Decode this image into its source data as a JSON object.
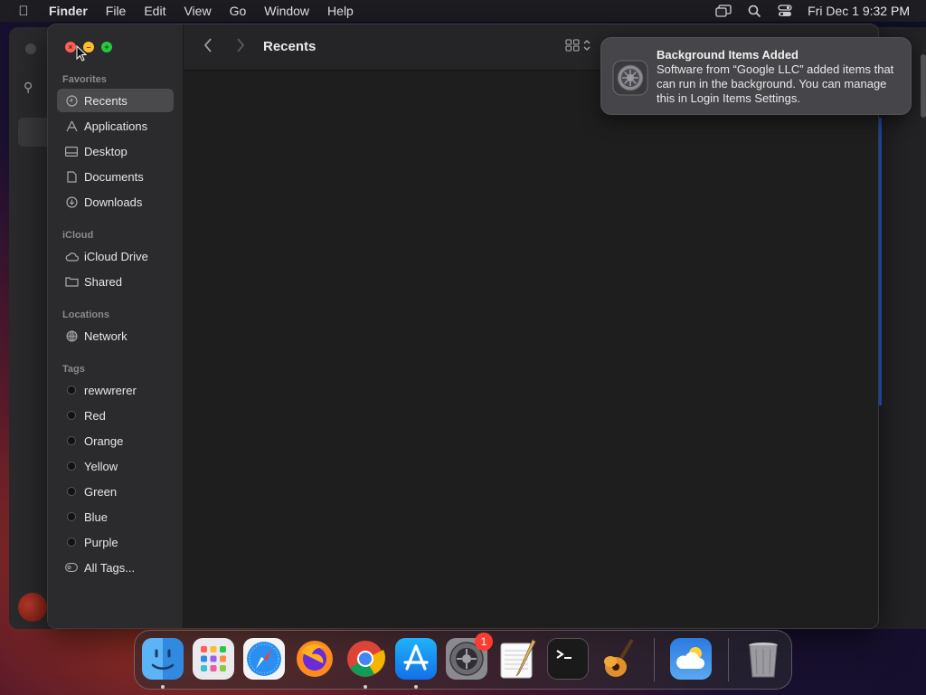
{
  "menubar": {
    "app_name": "Finder",
    "menus": [
      "File",
      "Edit",
      "View",
      "Go",
      "Window",
      "Help"
    ],
    "clock": "Fri Dec 1  9:32 PM",
    "status_icons": [
      "screen-mirroring-icon",
      "spotlight-search-icon",
      "control-center-icon"
    ]
  },
  "finder": {
    "title": "Recents",
    "sidebar": {
      "favorites_label": "Favorites",
      "favorites": [
        {
          "label": "Recents",
          "icon": "clock-icon",
          "selected": true
        },
        {
          "label": "Applications",
          "icon": "applications-icon"
        },
        {
          "label": "Desktop",
          "icon": "desktop-icon"
        },
        {
          "label": "Documents",
          "icon": "document-icon"
        },
        {
          "label": "Downloads",
          "icon": "downloads-icon"
        }
      ],
      "icloud_label": "iCloud",
      "icloud": [
        {
          "label": "iCloud Drive",
          "icon": "cloud-icon"
        },
        {
          "label": "Shared",
          "icon": "shared-folder-icon"
        }
      ],
      "locations_label": "Locations",
      "locations": [
        {
          "label": "Network",
          "icon": "network-icon"
        }
      ],
      "tags_label": "Tags",
      "tags": [
        "rewwrerer",
        "Red",
        "Orange",
        "Yellow",
        "Green",
        "Blue",
        "Purple"
      ],
      "all_tags": "All Tags..."
    }
  },
  "notification": {
    "title": "Background Items Added",
    "body": "Software from “Google LLC” added items that can run in the background. You can manage this in Login Items Settings.",
    "icon": "system-settings-icon"
  },
  "dock": {
    "apps": [
      "finder-icon",
      "launchpad-icon",
      "safari-icon",
      "firefox-icon",
      "chrome-icon",
      "app-store-icon",
      "system-settings-icon",
      "textedit-icon",
      "terminal-icon",
      "garageband-icon",
      "weather-icon",
      "trash-icon"
    ],
    "settings_badge": "1"
  },
  "colors": {
    "close": "#fe5f57",
    "minimize": "#febc2e",
    "zoom": "#28c840",
    "badge": "#ff3b30"
  }
}
